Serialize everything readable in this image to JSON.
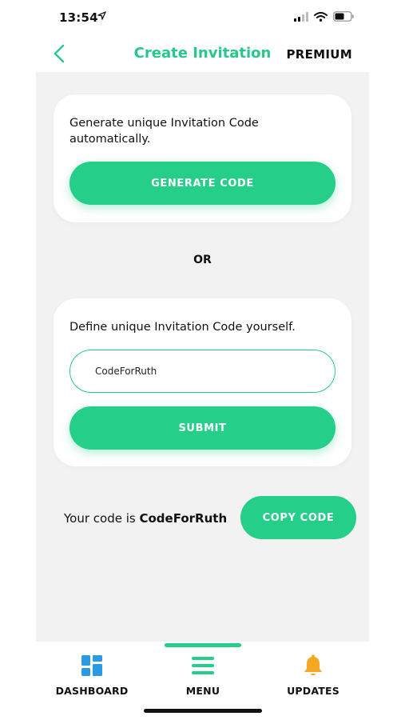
{
  "status_bar": {
    "time": "13:54",
    "icons": [
      "location-arrow-icon",
      "signal-icon",
      "wifi-icon",
      "battery-icon"
    ]
  },
  "header": {
    "back_icon": "chevron-left-icon",
    "title": "Create Invitation",
    "premium_label": "PREMIUM"
  },
  "generate_card": {
    "description": "Generate unique Invitation Code automatically.",
    "button_label": "GENERATE CODE"
  },
  "separator": "OR",
  "define_card": {
    "description": "Define unique Invitation Code yourself.",
    "input_value": "CodeForRuth",
    "button_label": "SUBMIT"
  },
  "result": {
    "prefix": "Your code is ",
    "code": "CodeForRuth",
    "copy_label": "COPY CODE"
  },
  "bottom_nav": {
    "items": [
      {
        "label": "DASHBOARD",
        "icon": "dashboard-icon"
      },
      {
        "label": "MENU",
        "icon": "menu-icon"
      },
      {
        "label": "UPDATES",
        "icon": "bell-icon"
      }
    ]
  },
  "colors": {
    "accent": "#25cf8a",
    "title": "#27c98a",
    "dashboard_icon": "#2a9be3",
    "bell_icon": "#f6a823",
    "background": "#f2f2f3"
  }
}
